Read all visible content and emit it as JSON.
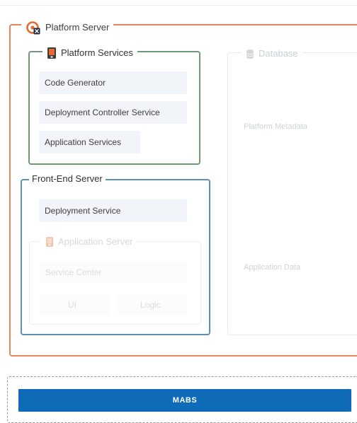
{
  "platform_server": {
    "title": "Platform Server",
    "icon": "platform-server-icon",
    "color": "#e8855a"
  },
  "platform_services": {
    "title": "Platform Services",
    "icon": "mobile-device-icon",
    "color": "#6f9a76",
    "items": [
      "Code Generator",
      "Deployment Controller Service",
      "Application Services"
    ]
  },
  "database": {
    "title": "Database",
    "icon": "database-icon",
    "items": [
      "Platform Metadata",
      "Application Data"
    ]
  },
  "frontend_server": {
    "title": "Front-End Server",
    "color": "#5b8fbe",
    "items": [
      "Deployment Service"
    ]
  },
  "application_server": {
    "title": "Application Server",
    "icon": "mobile-device-icon",
    "items": [
      "Service Center",
      "UI",
      "Logic"
    ]
  },
  "mabs": {
    "label": "MABS",
    "color": "#0f6bb7"
  }
}
